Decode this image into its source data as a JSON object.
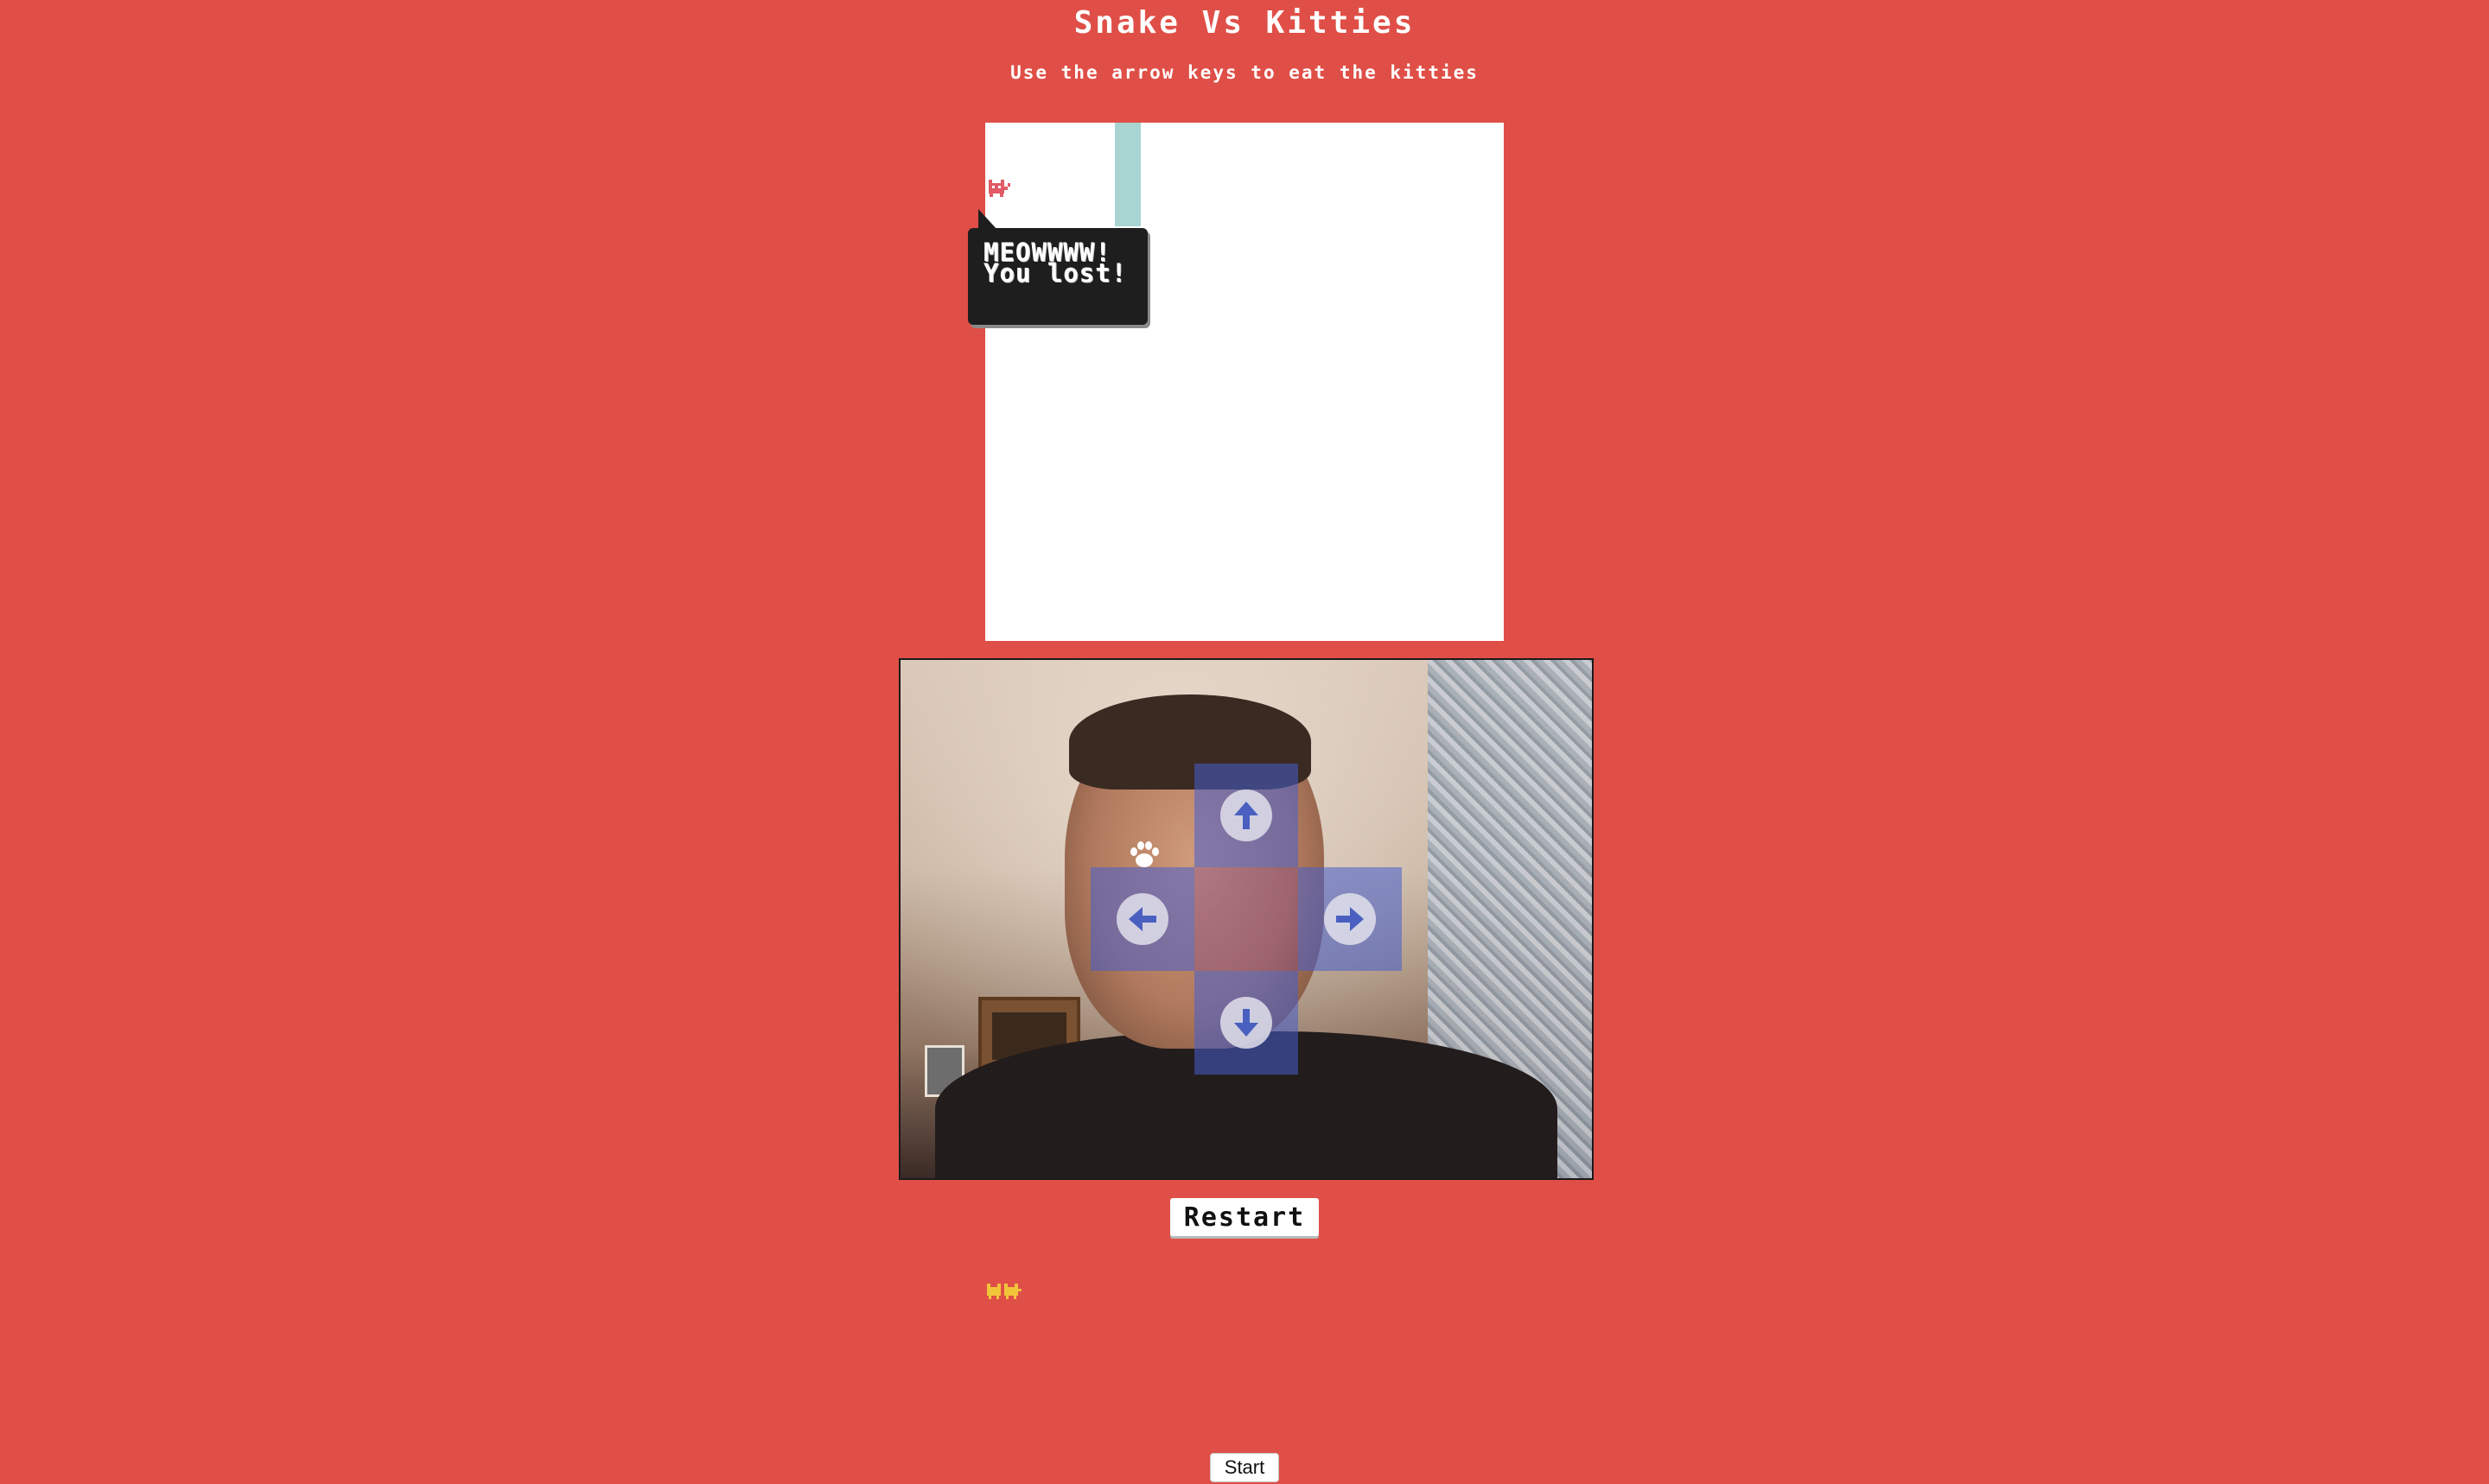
{
  "header": {
    "title": "Snake Vs Kitties",
    "subtitle": "Use the arrow keys to eat the kitties"
  },
  "game": {
    "message": "MEOWWWW! You lost!",
    "kitties_eaten": 2
  },
  "controls": {
    "up_icon": "arrow-up-circle-icon",
    "down_icon": "arrow-down-circle-icon",
    "left_icon": "arrow-left-circle-icon",
    "right_icon": "arrow-right-circle-icon",
    "cursor_icon": "paw-icon"
  },
  "buttons": {
    "restart_label": "Restart",
    "start_label": "Start"
  },
  "colors": {
    "background": "#df4f47",
    "snake": "#a8d4d2",
    "kitty": "#e15a66",
    "kitty_counter": "#f2c43a",
    "dpad": "#465fcd"
  }
}
